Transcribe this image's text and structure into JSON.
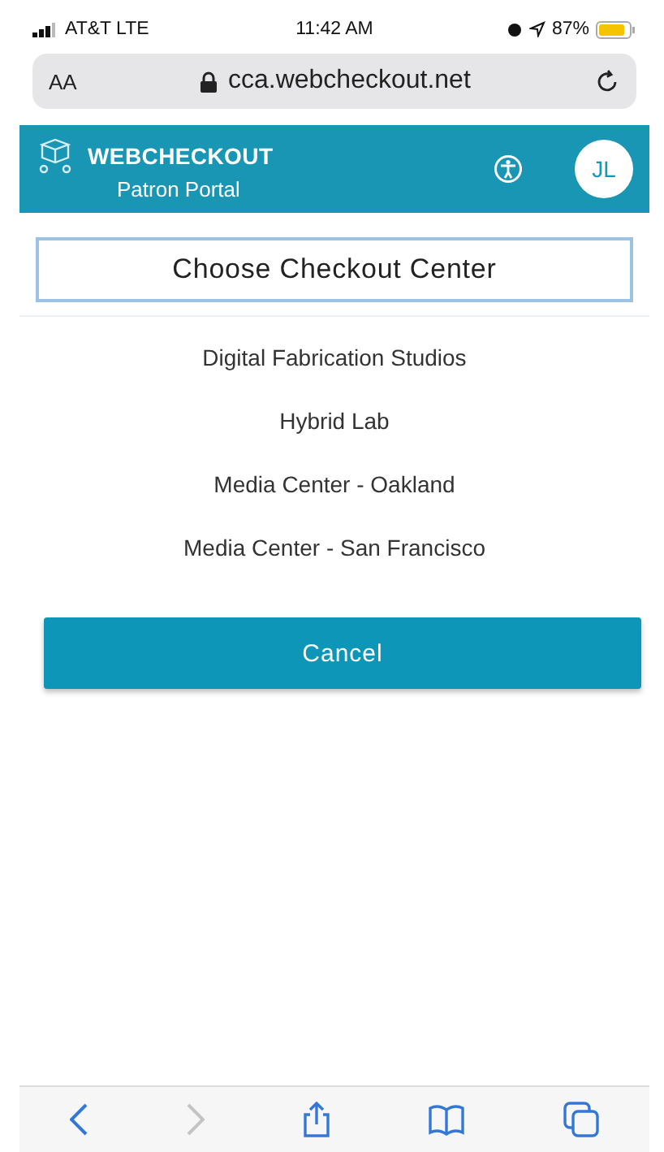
{
  "status_bar": {
    "carrier": "AT&T LTE",
    "time": "11:42 AM",
    "battery": "87%"
  },
  "address_bar": {
    "text_size": "AA",
    "url": "cca.webcheckout.net"
  },
  "header": {
    "logo": "WEBCHECKOUT",
    "subtitle": "Patron Portal",
    "avatar": "JL"
  },
  "title": "Choose Checkout Center",
  "centers": [
    {
      "name": "Digital Fabrication Studios"
    },
    {
      "name": "Hybrid Lab"
    },
    {
      "name": "Media Center - Oakland"
    },
    {
      "name": "Media Center - San Francisco"
    }
  ],
  "cancel_button": "Cancel",
  "toolbar": [
    {
      "kind": "back",
      "disabled": false
    },
    {
      "kind": "forward",
      "disabled": true
    },
    {
      "kind": "share",
      "disabled": false
    },
    {
      "kind": "bookmarks",
      "disabled": false
    },
    {
      "kind": "tabs",
      "disabled": false
    }
  ]
}
